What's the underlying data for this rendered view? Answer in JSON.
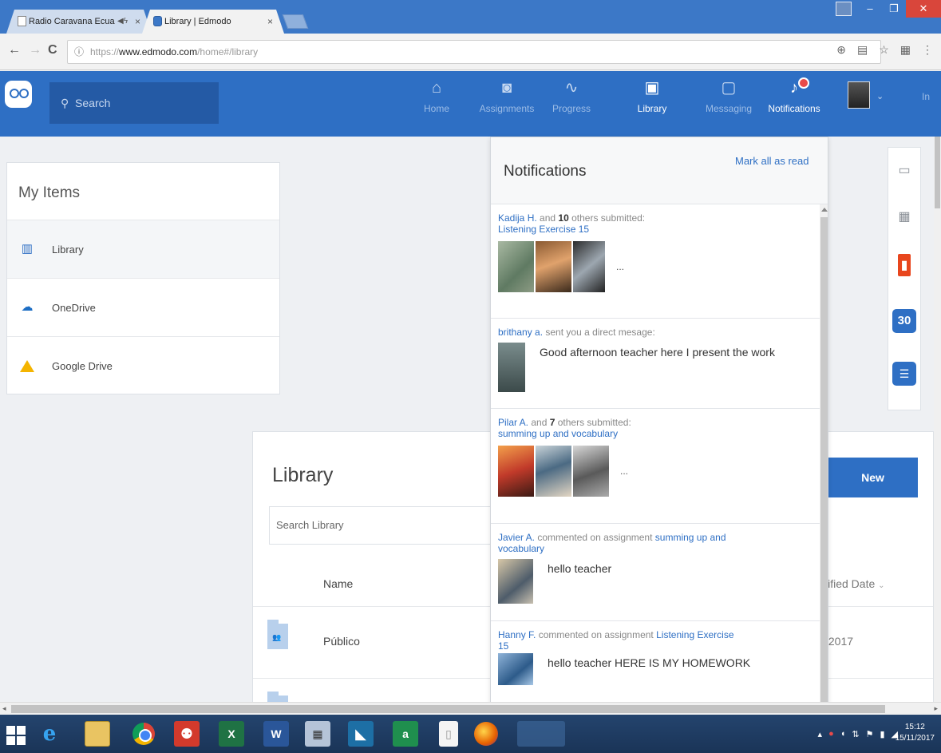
{
  "browser": {
    "tabs": [
      {
        "title": "Radio Caravana Ecua",
        "audio_icon": "speaker-icon",
        "active": false
      },
      {
        "title": "Library | Edmodo",
        "active": true
      }
    ],
    "close_glyph": "×",
    "url_scheme": "https://",
    "url_host": "www.edmodo.com",
    "url_path": "/home#/library"
  },
  "header": {
    "search_placeholder": "Search",
    "nav": [
      {
        "label": "Home",
        "icon": "home-icon"
      },
      {
        "label": "Assignments",
        "icon": "assignments-icon"
      },
      {
        "label": "Progress",
        "icon": "progress-icon"
      },
      {
        "label": "Library",
        "icon": "library-icon",
        "active": true
      },
      {
        "label": "Messaging",
        "icon": "messaging-icon"
      },
      {
        "label": "Notifications",
        "icon": "notifications-icon",
        "active": true
      }
    ],
    "cut_text": "In"
  },
  "my_items": {
    "title": "My Items",
    "items": [
      {
        "label": "Library",
        "icon": "library-book-icon"
      },
      {
        "label": "OneDrive",
        "icon": "onedrive-cloud-icon"
      },
      {
        "label": "Google Drive",
        "icon": "google-drive-icon"
      }
    ]
  },
  "library": {
    "title": "Library",
    "search_placeholder": "Search Library",
    "new_button": "New",
    "col_name": "Name",
    "col_modified": "lified Date",
    "rows": [
      {
        "name": "Público",
        "date": "/2017"
      }
    ]
  },
  "notifications": {
    "title": "Notifications",
    "mark_all": "Mark all as read",
    "items": [
      {
        "actor": "Kadija H.",
        "and": " and ",
        "count": "10",
        "rest": " others submitted:",
        "target": "Listening Exercise 15",
        "more": "..."
      },
      {
        "actor": "brithany a.",
        "rest": " sent you a direct mesage:",
        "message": "Good afternoon teacher here I present the work"
      },
      {
        "actor": "Pilar A.",
        "and": " and ",
        "count": "7",
        "rest": " others submitted:",
        "target": "summing up and vocabulary",
        "more": "..."
      },
      {
        "actor": "Javier A.",
        "rest": " commented on assignment ",
        "target": "summing up and vocabulary",
        "message": "hello teacher"
      },
      {
        "actor": "Hanny F.",
        "rest": " commented on assignment ",
        "target": "Listening Exercise 15",
        "message": "hello teacher HERE IS MY HOMEWORK"
      }
    ]
  },
  "apps": {
    "calendar_day": "30"
  },
  "taskbar": {
    "time": "15:12",
    "date": "15/11/2017",
    "excel_letter": "X",
    "word_letter": "W",
    "store_letter": "a",
    "ie_letter": "e"
  },
  "colors": {
    "brand_blue": "#2e6fc4",
    "notification_red": "#e84a4a"
  }
}
